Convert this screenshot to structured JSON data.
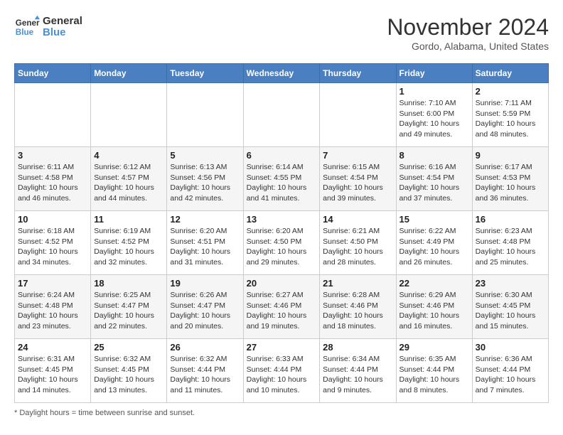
{
  "header": {
    "logo_line1": "General",
    "logo_line2": "Blue",
    "month": "November 2024",
    "location": "Gordo, Alabama, United States"
  },
  "days_of_week": [
    "Sunday",
    "Monday",
    "Tuesday",
    "Wednesday",
    "Thursday",
    "Friday",
    "Saturday"
  ],
  "footer": {
    "note": "Daylight hours"
  },
  "weeks": [
    [
      {
        "day": "",
        "info": ""
      },
      {
        "day": "",
        "info": ""
      },
      {
        "day": "",
        "info": ""
      },
      {
        "day": "",
        "info": ""
      },
      {
        "day": "",
        "info": ""
      },
      {
        "day": "1",
        "info": "Sunrise: 7:10 AM\nSunset: 6:00 PM\nDaylight: 10 hours\nand 49 minutes."
      },
      {
        "day": "2",
        "info": "Sunrise: 7:11 AM\nSunset: 5:59 PM\nDaylight: 10 hours\nand 48 minutes."
      }
    ],
    [
      {
        "day": "3",
        "info": "Sunrise: 6:11 AM\nSunset: 4:58 PM\nDaylight: 10 hours\nand 46 minutes."
      },
      {
        "day": "4",
        "info": "Sunrise: 6:12 AM\nSunset: 4:57 PM\nDaylight: 10 hours\nand 44 minutes."
      },
      {
        "day": "5",
        "info": "Sunrise: 6:13 AM\nSunset: 4:56 PM\nDaylight: 10 hours\nand 42 minutes."
      },
      {
        "day": "6",
        "info": "Sunrise: 6:14 AM\nSunset: 4:55 PM\nDaylight: 10 hours\nand 41 minutes."
      },
      {
        "day": "7",
        "info": "Sunrise: 6:15 AM\nSunset: 4:54 PM\nDaylight: 10 hours\nand 39 minutes."
      },
      {
        "day": "8",
        "info": "Sunrise: 6:16 AM\nSunset: 4:54 PM\nDaylight: 10 hours\nand 37 minutes."
      },
      {
        "day": "9",
        "info": "Sunrise: 6:17 AM\nSunset: 4:53 PM\nDaylight: 10 hours\nand 36 minutes."
      }
    ],
    [
      {
        "day": "10",
        "info": "Sunrise: 6:18 AM\nSunset: 4:52 PM\nDaylight: 10 hours\nand 34 minutes."
      },
      {
        "day": "11",
        "info": "Sunrise: 6:19 AM\nSunset: 4:52 PM\nDaylight: 10 hours\nand 32 minutes."
      },
      {
        "day": "12",
        "info": "Sunrise: 6:20 AM\nSunset: 4:51 PM\nDaylight: 10 hours\nand 31 minutes."
      },
      {
        "day": "13",
        "info": "Sunrise: 6:20 AM\nSunset: 4:50 PM\nDaylight: 10 hours\nand 29 minutes."
      },
      {
        "day": "14",
        "info": "Sunrise: 6:21 AM\nSunset: 4:50 PM\nDaylight: 10 hours\nand 28 minutes."
      },
      {
        "day": "15",
        "info": "Sunrise: 6:22 AM\nSunset: 4:49 PM\nDaylight: 10 hours\nand 26 minutes."
      },
      {
        "day": "16",
        "info": "Sunrise: 6:23 AM\nSunset: 4:48 PM\nDaylight: 10 hours\nand 25 minutes."
      }
    ],
    [
      {
        "day": "17",
        "info": "Sunrise: 6:24 AM\nSunset: 4:48 PM\nDaylight: 10 hours\nand 23 minutes."
      },
      {
        "day": "18",
        "info": "Sunrise: 6:25 AM\nSunset: 4:47 PM\nDaylight: 10 hours\nand 22 minutes."
      },
      {
        "day": "19",
        "info": "Sunrise: 6:26 AM\nSunset: 4:47 PM\nDaylight: 10 hours\nand 20 minutes."
      },
      {
        "day": "20",
        "info": "Sunrise: 6:27 AM\nSunset: 4:46 PM\nDaylight: 10 hours\nand 19 minutes."
      },
      {
        "day": "21",
        "info": "Sunrise: 6:28 AM\nSunset: 4:46 PM\nDaylight: 10 hours\nand 18 minutes."
      },
      {
        "day": "22",
        "info": "Sunrise: 6:29 AM\nSunset: 4:46 PM\nDaylight: 10 hours\nand 16 minutes."
      },
      {
        "day": "23",
        "info": "Sunrise: 6:30 AM\nSunset: 4:45 PM\nDaylight: 10 hours\nand 15 minutes."
      }
    ],
    [
      {
        "day": "24",
        "info": "Sunrise: 6:31 AM\nSunset: 4:45 PM\nDaylight: 10 hours\nand 14 minutes."
      },
      {
        "day": "25",
        "info": "Sunrise: 6:32 AM\nSunset: 4:45 PM\nDaylight: 10 hours\nand 13 minutes."
      },
      {
        "day": "26",
        "info": "Sunrise: 6:32 AM\nSunset: 4:44 PM\nDaylight: 10 hours\nand 11 minutes."
      },
      {
        "day": "27",
        "info": "Sunrise: 6:33 AM\nSunset: 4:44 PM\nDaylight: 10 hours\nand 10 minutes."
      },
      {
        "day": "28",
        "info": "Sunrise: 6:34 AM\nSunset: 4:44 PM\nDaylight: 10 hours\nand 9 minutes."
      },
      {
        "day": "29",
        "info": "Sunrise: 6:35 AM\nSunset: 4:44 PM\nDaylight: 10 hours\nand 8 minutes."
      },
      {
        "day": "30",
        "info": "Sunrise: 6:36 AM\nSunset: 4:44 PM\nDaylight: 10 hours\nand 7 minutes."
      }
    ]
  ]
}
